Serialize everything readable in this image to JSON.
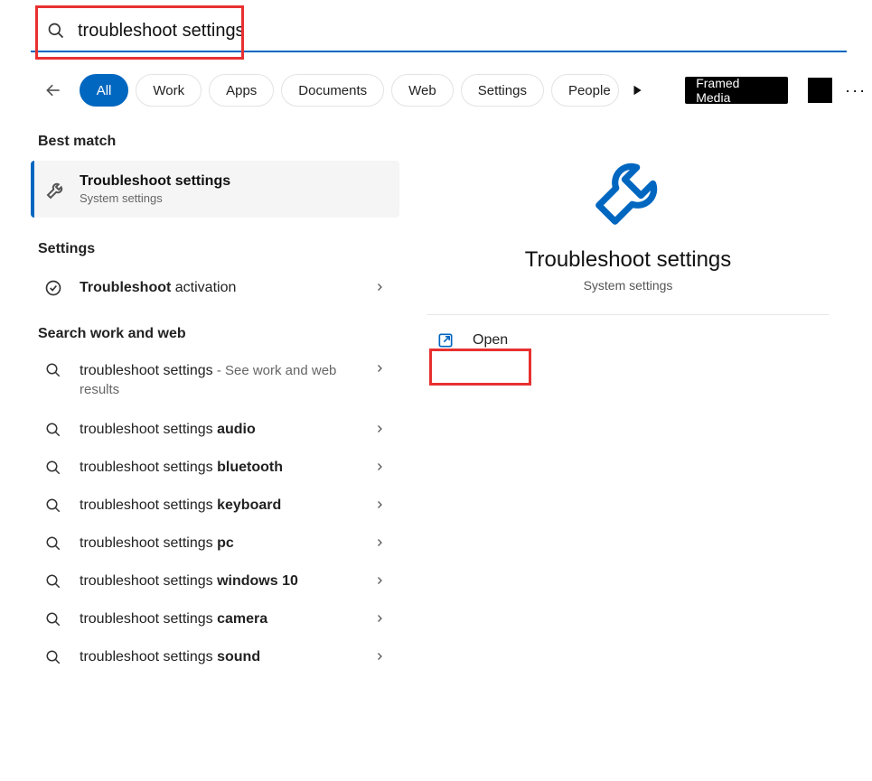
{
  "search": {
    "value": "troubleshoot settings"
  },
  "tabs": {
    "items": [
      "All",
      "Work",
      "Apps",
      "Documents",
      "Web",
      "Settings",
      "People"
    ],
    "framed": "Framed Media"
  },
  "left": {
    "best_label": "Best match",
    "best": {
      "title": "Troubleshoot settings",
      "subtitle": "System settings"
    },
    "settings_label": "Settings",
    "settings_items": [
      {
        "bold": "Troubleshoot",
        "rest": " activation"
      }
    ],
    "web_label": "Search work and web",
    "web_items": [
      {
        "main": "troubleshoot settings",
        "suffix": " - See work and web results"
      },
      {
        "main": "troubleshoot settings ",
        "bold": "audio"
      },
      {
        "main": "troubleshoot settings ",
        "bold": "bluetooth"
      },
      {
        "main": "troubleshoot settings ",
        "bold": "keyboard"
      },
      {
        "main": "troubleshoot settings ",
        "bold": "pc"
      },
      {
        "main": "troubleshoot settings ",
        "bold": "windows 10"
      },
      {
        "main": "troubleshoot settings ",
        "bold": "camera"
      },
      {
        "main": "troubleshoot settings ",
        "bold": "sound"
      }
    ]
  },
  "right": {
    "title": "Troubleshoot settings",
    "subtitle": "System settings",
    "open": "Open"
  },
  "colors": {
    "accent": "#0067c0",
    "highlight": "#e83030"
  }
}
